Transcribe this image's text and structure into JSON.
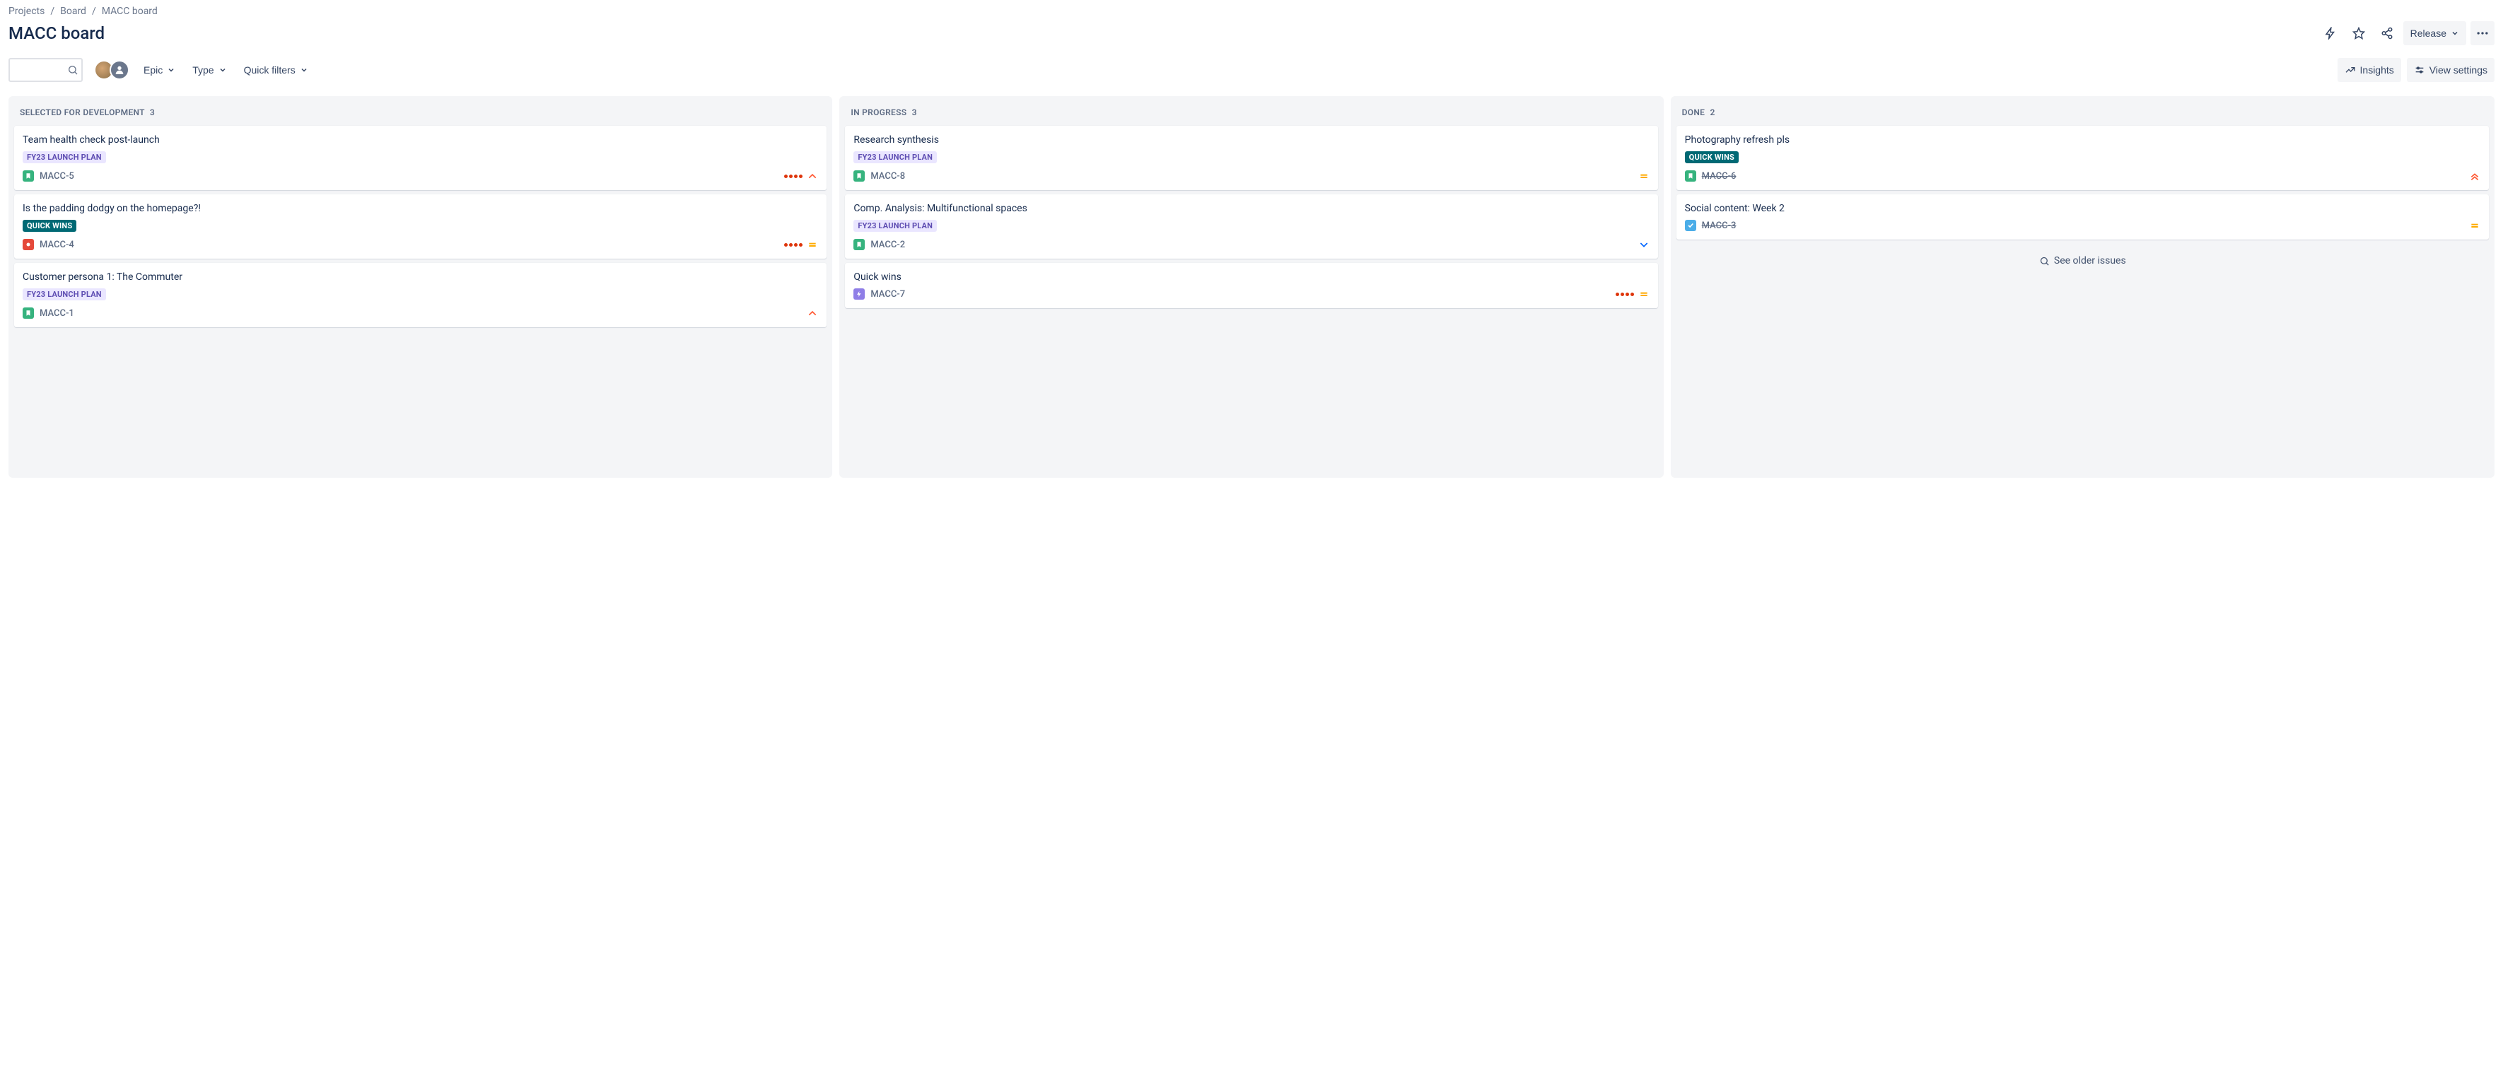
{
  "breadcrumbs": [
    {
      "label": "Projects"
    },
    {
      "label": "Board"
    },
    {
      "label": "MACC board"
    }
  ],
  "page_title": "MACC board",
  "header": {
    "release_label": "Release"
  },
  "toolbar": {
    "epic_label": "Epic",
    "type_label": "Type",
    "quick_filters_label": "Quick filters",
    "insights_label": "Insights",
    "view_settings_label": "View settings"
  },
  "columns": [
    {
      "title": "SELECTED FOR DEVELOPMENT",
      "count": "3",
      "cards": [
        {
          "title": "Team health check post-launch",
          "tag": "FY23 LAUNCH PLAN",
          "tag_style": "purple",
          "type": "story",
          "key": "MACC-5",
          "dots": true,
          "priority": "high",
          "done": false
        },
        {
          "title": "Is the padding dodgy on the homepage?!",
          "tag": "QUICK WINS",
          "tag_style": "teal",
          "type": "bug",
          "key": "MACC-4",
          "dots": true,
          "priority": "medium",
          "done": false
        },
        {
          "title": "Customer persona 1: The Commuter",
          "tag": "FY23 LAUNCH PLAN",
          "tag_style": "purple",
          "type": "story",
          "key": "MACC-1",
          "dots": false,
          "priority": "high",
          "done": false
        }
      ]
    },
    {
      "title": "IN PROGRESS",
      "count": "3",
      "cards": [
        {
          "title": "Research synthesis",
          "tag": "FY23 LAUNCH PLAN",
          "tag_style": "purple",
          "type": "story",
          "key": "MACC-8",
          "dots": false,
          "priority": "medium",
          "done": false
        },
        {
          "title": "Comp. Analysis: Multifunctional spaces",
          "tag": "FY23 LAUNCH PLAN",
          "tag_style": "purple",
          "type": "story",
          "key": "MACC-2",
          "dots": false,
          "priority": "low",
          "done": false
        },
        {
          "title": "Quick wins",
          "tag": null,
          "tag_style": null,
          "type": "epic",
          "key": "MACC-7",
          "dots": true,
          "priority": "medium",
          "done": false
        }
      ]
    },
    {
      "title": "DONE",
      "count": "2",
      "older_label": "See older issues",
      "cards": [
        {
          "title": "Photography refresh pls",
          "tag": "QUICK WINS",
          "tag_style": "teal",
          "type": "story",
          "key": "MACC-6",
          "dots": false,
          "priority": "highest",
          "done": true
        },
        {
          "title": "Social content: Week 2",
          "tag": null,
          "tag_style": null,
          "type": "task",
          "key": "MACC-3",
          "dots": false,
          "priority": "medium",
          "done": true
        }
      ]
    }
  ]
}
